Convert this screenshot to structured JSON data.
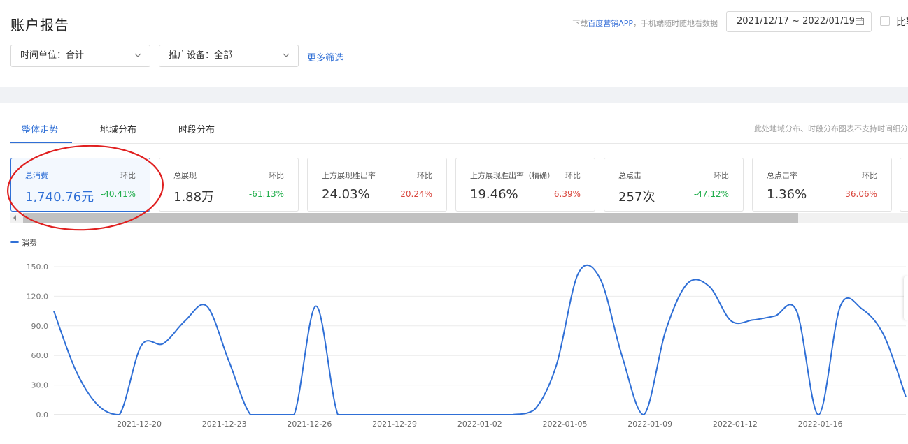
{
  "header": {
    "title": "账户报告",
    "app_promo_prefix": "下载",
    "app_promo_link": "百度营销APP",
    "app_promo_suffix": "，手机端随时随地看数据",
    "date_range": "2021/12/17 ~ 2022/01/19",
    "compare_label": "比较"
  },
  "filters": {
    "time_unit": "时间单位：合计",
    "device": "推广设备：全部",
    "more_filters": "更多筛选"
  },
  "tabs": [
    {
      "label": "整体走势",
      "active": true
    },
    {
      "label": "地域分布",
      "active": false
    },
    {
      "label": "时段分布",
      "active": false
    }
  ],
  "tab_note": "此处地域分布、时段分布图表不支持时间细分",
  "metrics": [
    {
      "label": "总消费",
      "hb_label": "环比",
      "value": "1,740.76元",
      "change": "-40.41%",
      "trend": "down",
      "active": true
    },
    {
      "label": "总展现",
      "hb_label": "环比",
      "value": "1.88万",
      "change": "-61.13%",
      "trend": "down",
      "active": false
    },
    {
      "label": "上方展现胜出率",
      "hb_label": "环比",
      "value": "24.03%",
      "change": "20.24%",
      "trend": "up",
      "active": false
    },
    {
      "label": "上方展现胜出率（精确）",
      "hb_label": "环比",
      "value": "19.46%",
      "change": "6.39%",
      "trend": "up",
      "active": false
    },
    {
      "label": "总点击",
      "hb_label": "环比",
      "value": "257次",
      "change": "-47.12%",
      "trend": "down",
      "active": false
    },
    {
      "label": "总点击率",
      "hb_label": "环比",
      "value": "1.36%",
      "change": "36.06%",
      "trend": "up",
      "active": false
    }
  ],
  "colors": {
    "accent": "#2f6fd6",
    "up": "#d9453c",
    "down": "#1fad4a",
    "annotation": "#e02020"
  },
  "chart_data": {
    "type": "line",
    "series": [
      {
        "name": "消费",
        "color": "#2f6fd6",
        "values": [
          105,
          45,
          10,
          0,
          70,
          72,
          95,
          110,
          55,
          0,
          0,
          0,
          110,
          0,
          0,
          0,
          0,
          0,
          0,
          0,
          0,
          0,
          5,
          50,
          143,
          138,
          60,
          0,
          85,
          133,
          130,
          95,
          96,
          100,
          105,
          0,
          110,
          107,
          80,
          18
        ]
      }
    ],
    "x_tick_labels": [
      "2021-12-20",
      "2021-12-23",
      "2021-12-26",
      "2021-12-29",
      "2022-01-02",
      "2022-01-05",
      "2022-01-09",
      "2022-01-12",
      "2022-01-16"
    ],
    "y_tick_labels": [
      "0.0",
      "30.0",
      "60.0",
      "90.0",
      "120.0",
      "150.0"
    ],
    "ylim": [
      0,
      150
    ],
    "grid": true,
    "legend": "top-left"
  }
}
